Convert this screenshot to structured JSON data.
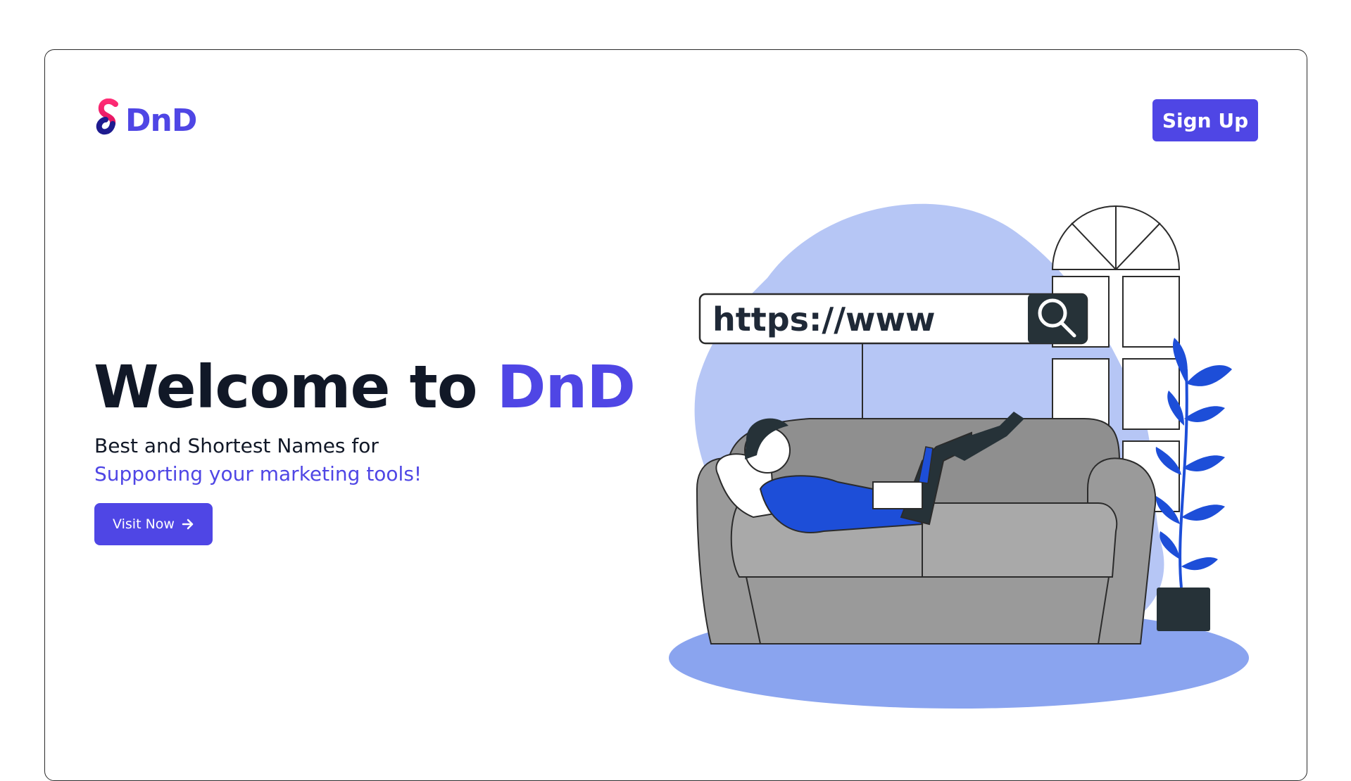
{
  "header": {
    "logo_text": "DnD",
    "signup_label": "Sign Up"
  },
  "hero": {
    "title_prefix": "Welcome to ",
    "title_accent": "DnD",
    "subtitle_line1": "Best and Shortest Names for",
    "subtitle_line2": "Supporting your marketing tools!",
    "cta_label": "Visit Now",
    "cta_icon": "arrow-right-icon"
  },
  "illustration": {
    "url_bar_text": "https://www",
    "search_icon": "search-icon"
  },
  "colors": {
    "accent": "#4f46e5",
    "text_dark": "#111827",
    "blob": "#b6c6f5",
    "floor": "#8aa4ef",
    "sofa": "#9a9a9a",
    "plant": "#1d4ed8"
  }
}
